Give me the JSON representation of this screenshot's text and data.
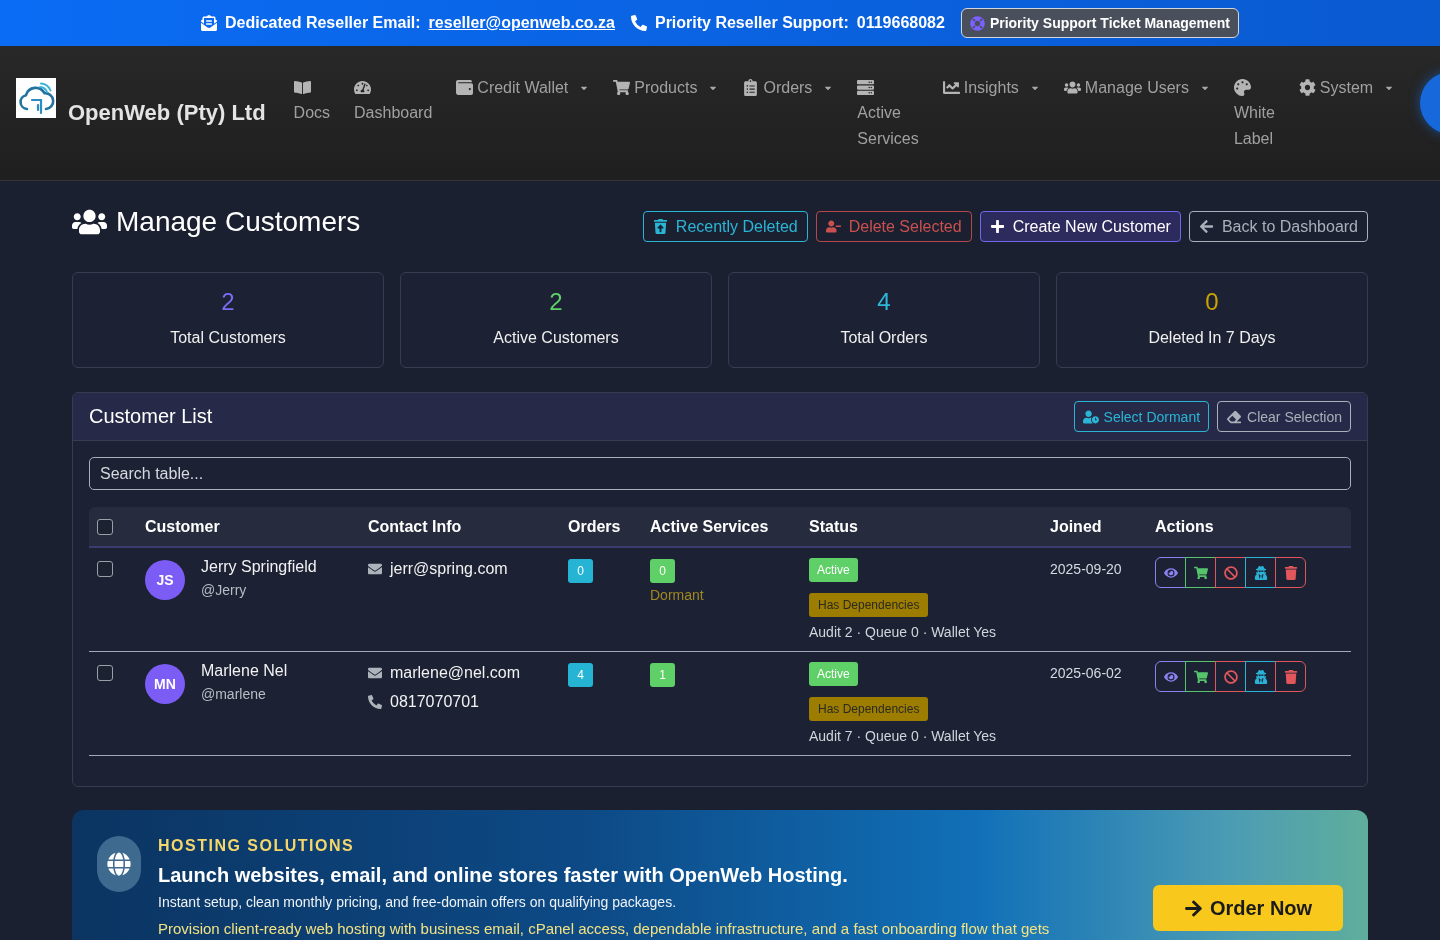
{
  "top_bar": {
    "email_label": "Dedicated Reseller Email:",
    "email": "reseller@openweb.co.za",
    "support_label": "Priority Reseller Support:",
    "phone": "0119668082",
    "ticket_button": "Priority Support Ticket Management"
  },
  "navbar": {
    "brand": "OpenWeb (Pty) Ltd",
    "items": [
      {
        "label": "Docs",
        "kind": "stacked"
      },
      {
        "label": "Dashboard",
        "kind": "stacked"
      },
      {
        "label": "Credit Wallet",
        "kind": "dropdown"
      },
      {
        "label": "Products",
        "kind": "dropdown"
      },
      {
        "label": "Orders",
        "kind": "dropdown"
      },
      {
        "label": "Active Services",
        "kind": "stacked"
      },
      {
        "label": "Insights",
        "kind": "dropdown"
      },
      {
        "label": "Manage Users",
        "kind": "dropdown"
      },
      {
        "label": "White Label",
        "kind": "stacked"
      },
      {
        "label": "System",
        "kind": "dropdown"
      }
    ]
  },
  "page": {
    "title": "Manage Customers",
    "actions": [
      {
        "label": "Recently Deleted",
        "kind": "info"
      },
      {
        "label": "Delete Selected",
        "kind": "danger"
      },
      {
        "label": "Create New Customer",
        "kind": "primary"
      },
      {
        "label": "Back to Dashboard",
        "kind": "secondary"
      }
    ]
  },
  "stats": [
    {
      "value": "2",
      "label": "Total Customers",
      "color": "#7b6cf2"
    },
    {
      "value": "2",
      "label": "Active Customers",
      "color": "#5fd068"
    },
    {
      "value": "4",
      "label": "Total Orders",
      "color": "#2fb6d8"
    },
    {
      "value": "0",
      "label": "Deleted In 7 Days",
      "color": "#c9a300"
    }
  ],
  "customer_list": {
    "title": "Customer List",
    "buttons": [
      {
        "label": "Select Dormant",
        "kind": "info"
      },
      {
        "label": "Clear Selection",
        "kind": "secondary"
      }
    ],
    "search": {
      "placeholder": "Search table..."
    },
    "table": {
      "select_all": {
        "checked": false
      },
      "columns": [
        "Customer",
        "Contact Info",
        "Orders",
        "Active Services",
        "Status",
        "Joined",
        "Actions"
      ],
      "rows": [
        {
          "selected": false,
          "initials": "JS",
          "name": "Jerry Springfield",
          "handle": "@Jerry",
          "contacts": [
            {
              "kind": "email",
              "text": "jerr@spring.com"
            }
          ],
          "orders": "0",
          "services": "0",
          "services_note": "Dormant",
          "status": {
            "label": "Active",
            "kind": "success"
          },
          "dependency": "Has Dependencies",
          "summary": "Audit 2 · Queue 0 · Wallet Yes",
          "joined": "2025-09-20"
        },
        {
          "selected": false,
          "initials": "MN",
          "name": "Marlene Nel",
          "handle": "@marlene",
          "contacts": [
            {
              "kind": "email",
              "text": "marlene@nel.com"
            },
            {
              "kind": "phone",
              "text": "0817070701"
            }
          ],
          "orders": "4",
          "services": "1",
          "status": {
            "label": "Active",
            "kind": "success"
          },
          "dependency": "Has Dependencies",
          "summary": "Audit 7 · Queue 0 · Wallet Yes",
          "joined": "2025-06-02"
        }
      ]
    }
  },
  "banner": {
    "eyebrow": "HOSTING SOLUTIONS",
    "heading": "Launch websites, email, and online stores faster with OpenWeb Hosting.",
    "subtext": "Instant setup, clean monthly pricing, and free-domain offers on qualifying packages.",
    "body": "Provision client-ready web hosting with business email, cPanel access, dependable infrastructure, and a fast onboarding flow that gets",
    "button": "Order Now"
  }
}
